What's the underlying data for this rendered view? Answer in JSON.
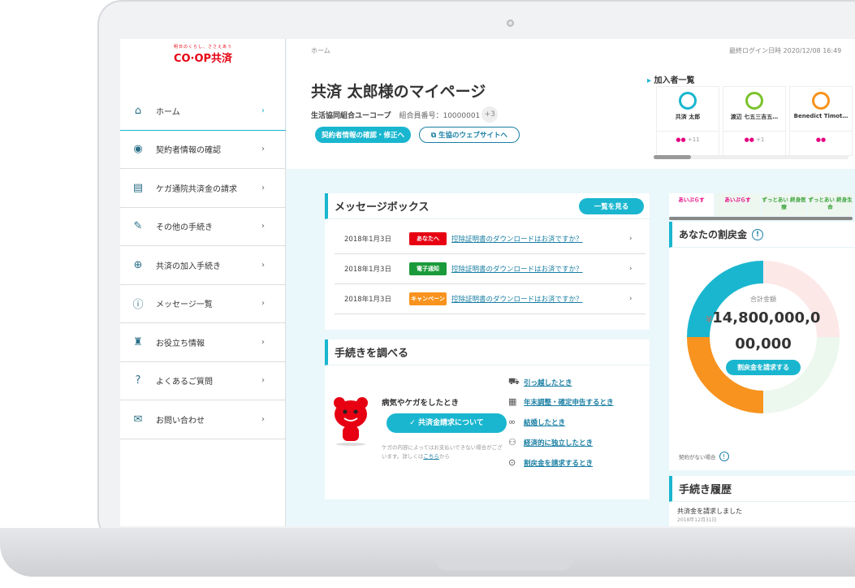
{
  "brand": {
    "logo": "CO·OP共済",
    "tagline": "明日のくらし、ささえあう",
    "color": "#e60012"
  },
  "accent": "#1ab6cf",
  "sidebar": {
    "items": [
      {
        "label": "ホーム",
        "icon": "home-icon",
        "glyph": "⌂"
      },
      {
        "label": "契約者情報の確認",
        "icon": "user-icon",
        "glyph": "◉"
      },
      {
        "label": "ケガ通院共済金の請求",
        "icon": "document-icon",
        "glyph": "▤"
      },
      {
        "label": "その他の手続き",
        "icon": "edit-icon",
        "glyph": "✎"
      },
      {
        "label": "共済の加入手続き",
        "icon": "plus-circle-icon",
        "glyph": "⊕"
      },
      {
        "label": "メッセージ一覧",
        "icon": "alert-circle-icon",
        "glyph": "ⓘ"
      },
      {
        "label": "お役立ち情報",
        "icon": "lighthouse-icon",
        "glyph": "♜"
      },
      {
        "label": "よくあるご質問",
        "icon": "question-icon",
        "glyph": "?"
      },
      {
        "label": "お問い合わせ",
        "icon": "mail-icon",
        "glyph": "✉"
      }
    ]
  },
  "header": {
    "breadcrumb": "ホーム",
    "last_login": "最終ログイン日時 2020/12/08 16:49",
    "title": "共済 太郎様のマイページ",
    "coop": "生活協同組合ユーコープ",
    "member_no": "組合員番号：10000001",
    "extra": "+3",
    "btn_edit": "契約者情報の確認・修正へ",
    "btn_site": "生協のウェブサイトへ"
  },
  "members": {
    "title": "加入者一覧",
    "items": [
      {
        "name": "共済 太郎",
        "color": "#1ab6cf",
        "more": "+11"
      },
      {
        "name": "渡辺 七五三吉五…",
        "color": "#7cc22e",
        "more": "+1"
      },
      {
        "name": "Benedict Timot…",
        "color": "#f7931e",
        "more": ""
      }
    ]
  },
  "messages": {
    "title": "メッセージボックス",
    "view_all": "一覧を見る",
    "rows": [
      {
        "date": "2018年1月3日",
        "tag": "あなたへ",
        "tag_color": "#e60012",
        "text": "控除証明書のダウンロードはお済ですか？"
      },
      {
        "date": "2018年1月3日",
        "tag": "電子通知",
        "tag_color": "#1a9a3a",
        "text": "控除証明書のダウンロードはお済ですか？"
      },
      {
        "date": "2018年1月3日",
        "tag": "キャンペーン",
        "tag_color": "#f7931e",
        "text": "控除証明書のダウンロードはお済ですか？"
      }
    ]
  },
  "procedures": {
    "title": "手続きを調べる",
    "sick_title": "病気やケガをしたとき",
    "claim_btn": "共済金請求について",
    "note": "ケガの内容によってはお支払いできない場合がございます。詳しくは",
    "note_link": "こちら",
    "note_end": "から",
    "links": [
      {
        "label": "引っ越したとき",
        "icon": "truck-icon",
        "glyph": "⛟"
      },
      {
        "label": "年末調整・確定申告するとき",
        "icon": "calendar-icon",
        "glyph": "▦"
      },
      {
        "label": "結婚したとき",
        "icon": "rings-icon",
        "glyph": "∞"
      },
      {
        "label": "経済的に独立したとき",
        "icon": "family-icon",
        "glyph": "⚇"
      },
      {
        "label": "割戻金を請求するとき",
        "icon": "refund-icon",
        "glyph": "⊙"
      }
    ]
  },
  "product_tabs": [
    "あいぷらす",
    "あいぷらす",
    "ずっとあい 終身医療",
    "ずっとあい 終身生命"
  ],
  "refund": {
    "title": "あなたの割戻金",
    "total_label": "合計金額",
    "currency": "¥",
    "amount_line1": "14,800,000,0",
    "amount_line2": "00,000",
    "claim_btn": "割戻金を請求する",
    "no_contract": "契約がない場合",
    "segments": [
      {
        "color": "#1ab6cf",
        "value": 25
      },
      {
        "color": "#fde8e8",
        "value": 25
      },
      {
        "color": "#ecf7ee",
        "value": 25
      },
      {
        "color": "#f7931e",
        "value": 25
      }
    ]
  },
  "history": {
    "title": "手続き履歴",
    "item": "共済金を請求しました",
    "date": "2018年12月31日"
  }
}
